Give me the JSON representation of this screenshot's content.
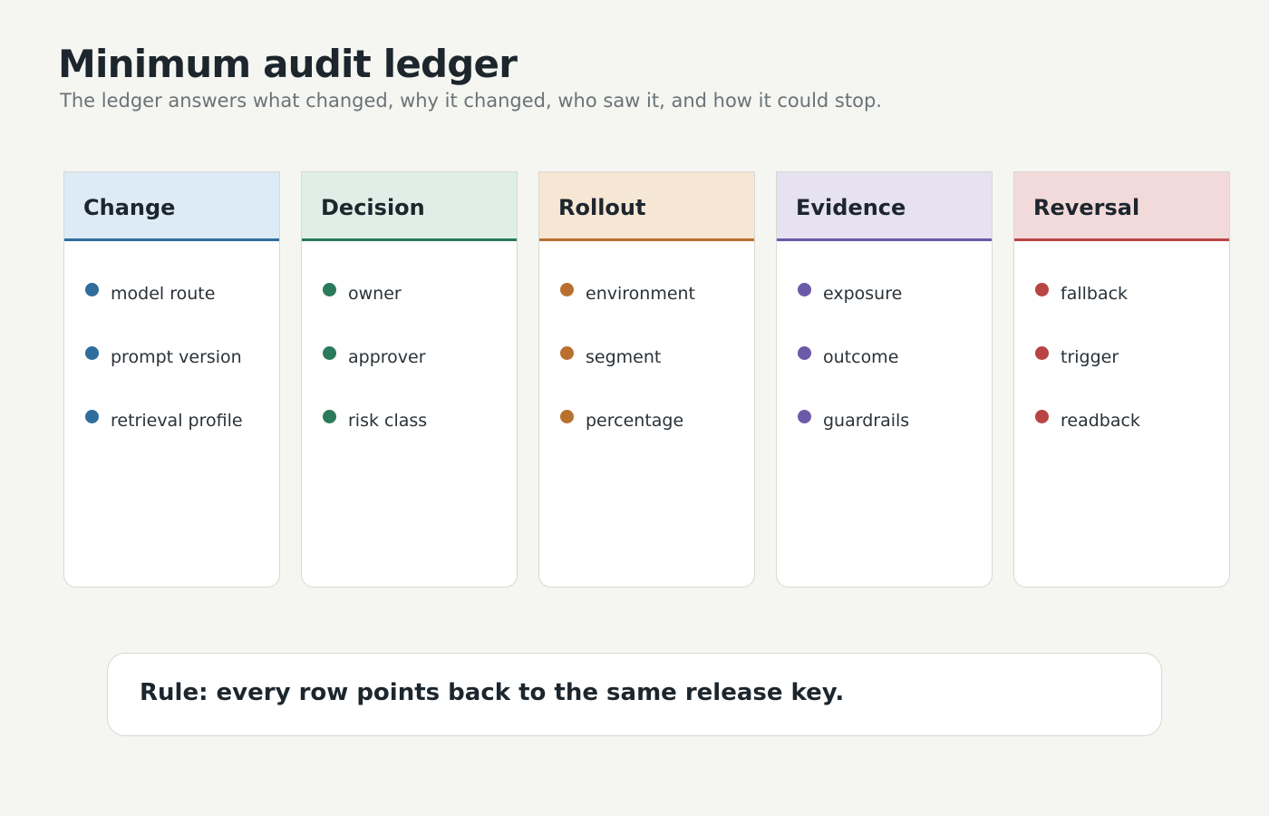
{
  "header": {
    "title": "Minimum audit ledger",
    "subtitle": "The ledger answers what changed, why it changed, who saw it, and how it could stop."
  },
  "columns": [
    {
      "title": "Change",
      "header_bg": "#dcebf5",
      "accent": "#2e6d9c",
      "items": [
        "model route",
        "prompt version",
        "retrieval profile"
      ]
    },
    {
      "title": "Decision",
      "header_bg": "#dfefe8",
      "accent": "#2a7a5c",
      "items": [
        "owner",
        "approver",
        "risk class"
      ]
    },
    {
      "title": "Rollout",
      "header_bg": "#f6e6d4",
      "accent": "#b9702e",
      "items": [
        "environment",
        "segment",
        "percentage"
      ]
    },
    {
      "title": "Evidence",
      "header_bg": "#e6e2f2",
      "accent": "#6b5aa8",
      "items": [
        "exposure",
        "outcome",
        "guardrails"
      ]
    },
    {
      "title": "Reversal",
      "header_bg": "#f3dada",
      "accent": "#b94444",
      "items": [
        "fallback",
        "trigger",
        "readback"
      ]
    }
  ],
  "rule": {
    "text": "Rule: every row points back to the same release key."
  }
}
